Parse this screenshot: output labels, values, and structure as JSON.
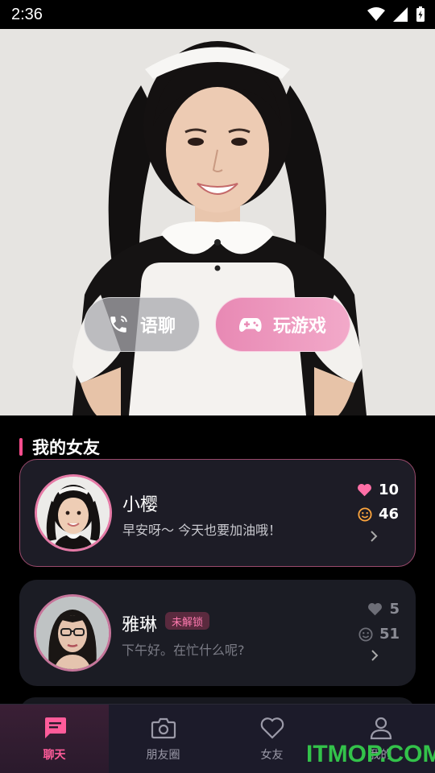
{
  "status_bar": {
    "time": "2:36"
  },
  "hero": {
    "voice_label": "语聊",
    "game_label": "玩游戏"
  },
  "section": {
    "title": "我的女友"
  },
  "girlfriends": [
    {
      "name": "小樱",
      "message": "早安呀～ 今天也要加油哦！",
      "likes": "10",
      "mood": "46",
      "locked": false
    },
    {
      "name": "雅琳",
      "badge": "未解锁",
      "message": "下午好。在忙什么呢?",
      "likes": "5",
      "mood": "51",
      "locked": true
    }
  ],
  "tabs": [
    {
      "label": "聊天",
      "icon": "chat-icon",
      "active": true
    },
    {
      "label": "朋友圈",
      "icon": "camera-icon",
      "active": false
    },
    {
      "label": "女友",
      "icon": "heart-icon",
      "active": false
    },
    {
      "label": "我的",
      "icon": "person-icon",
      "active": false
    }
  ],
  "watermark": "ITMOP.COM",
  "colors": {
    "accent": "#ff5c9a",
    "card_bg": "#1b1c24",
    "tab_bg": "#1c1b2a"
  }
}
